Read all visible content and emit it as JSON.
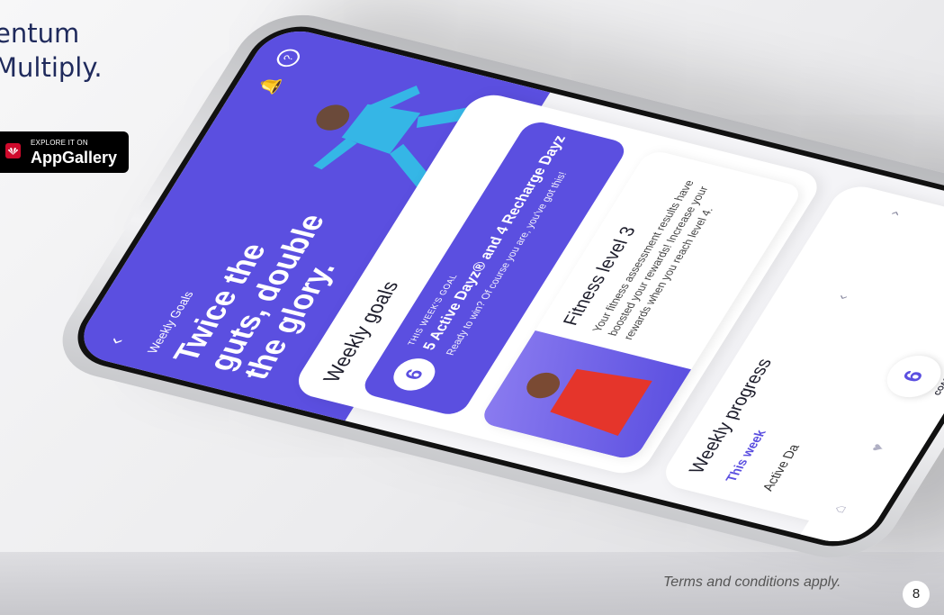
{
  "headline": {
    "line1": "entum",
    "line2": "Multiply."
  },
  "store_badge": {
    "small_label": "EXPLORE IT ON",
    "big_label": "AppGallery",
    "brand_color": "#cf0a2c"
  },
  "app": {
    "accent": "#5b4fe0",
    "hero": {
      "eyebrow": "Weekly Goals",
      "title": "Twice the guts, double the glory."
    },
    "goals_card": {
      "title": "Weekly goals",
      "goal_tag": "THIS WEEK'S GOAL",
      "goal_value": "5 Active Dayz® and 4 Recharge Dayz",
      "goal_sub": "Ready to win? Of course you are, you've got this!"
    },
    "fitness_card": {
      "title": "Fitness level 3",
      "description": "Your fitness assessment results have boosted your rewards! Increase your rewards when you reach level 4."
    },
    "progress_card": {
      "title": "Weekly progress",
      "period": "This week",
      "metric_label": "Active Da"
    },
    "nav": {
      "coach_label": "COACH"
    }
  },
  "footer": {
    "terms": "Terms and conditions apply.",
    "page_number": "8"
  }
}
